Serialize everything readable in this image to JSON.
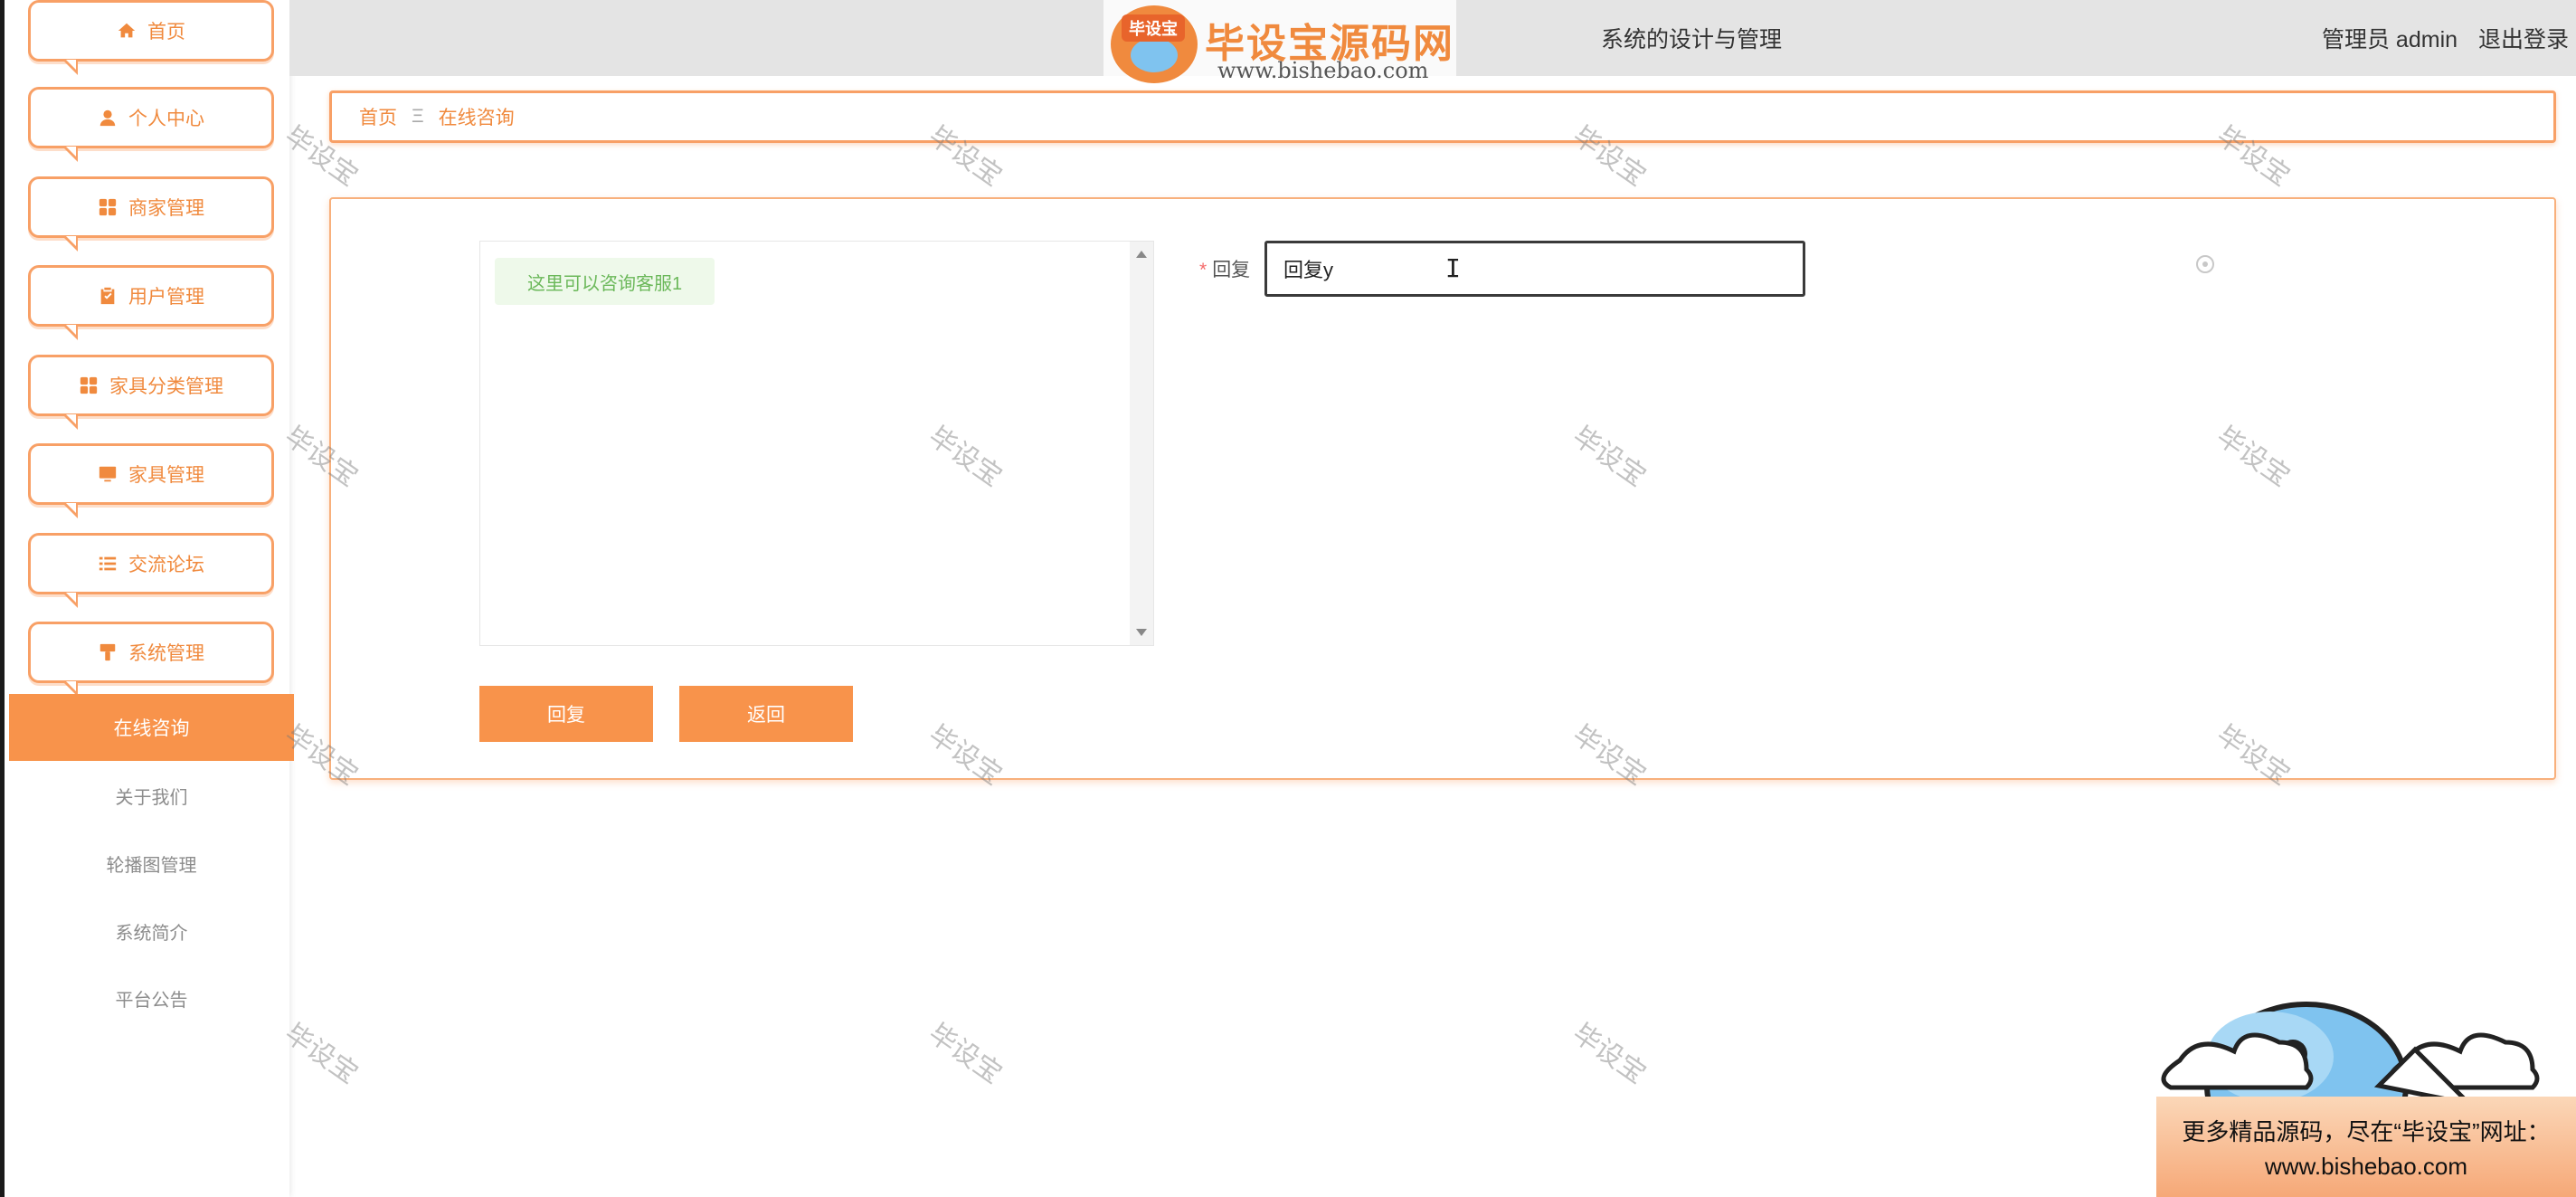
{
  "header": {
    "system_title": "系统的设计与管理",
    "user_label": "管理员 admin",
    "logout_label": "退出登录"
  },
  "logo_overlay": {
    "badge": "毕设宝",
    "title": "毕设宝源码网",
    "url": "www.bishebao.com"
  },
  "sidebar": {
    "items": [
      {
        "label": "首页",
        "icon": "home-icon"
      },
      {
        "label": "个人中心",
        "icon": "user-icon"
      },
      {
        "label": "商家管理",
        "icon": "grid-icon"
      },
      {
        "label": "用户管理",
        "icon": "clipboard-icon"
      },
      {
        "label": "家具分类管理",
        "icon": "grid-icon"
      },
      {
        "label": "家具管理",
        "icon": "monitor-icon"
      },
      {
        "label": "交流论坛",
        "icon": "list-icon"
      },
      {
        "label": "系统管理",
        "icon": "brush-icon"
      }
    ],
    "sub_items": [
      {
        "label": "在线咨询",
        "active": true
      },
      {
        "label": "关于我们",
        "active": false
      },
      {
        "label": "轮播图管理",
        "active": false
      },
      {
        "label": "系统简介",
        "active": false
      },
      {
        "label": "平台公告",
        "active": false
      }
    ]
  },
  "breadcrumb": {
    "home": "首页",
    "separator": "Ξ",
    "current": "在线咨询"
  },
  "chat": {
    "messages": [
      "这里可以咨询客服1"
    ]
  },
  "form": {
    "reply_label": "回复",
    "required_mark": "*",
    "reply_value": "回复y",
    "reply_button": "回复",
    "back_button": "返回"
  },
  "watermark_text": "毕设宝",
  "promo": {
    "line1": "更多精品源码，尽在“毕设宝”网址：",
    "line2": "www.bishebao.com"
  },
  "colors": {
    "accent": "#f8934b",
    "accent_text": "#f08a3e",
    "border": "#f8a066",
    "topbar_bg": "#e4e4e4",
    "chat_bubble_bg": "#eef9ea",
    "chat_bubble_text": "#6bb85a"
  }
}
